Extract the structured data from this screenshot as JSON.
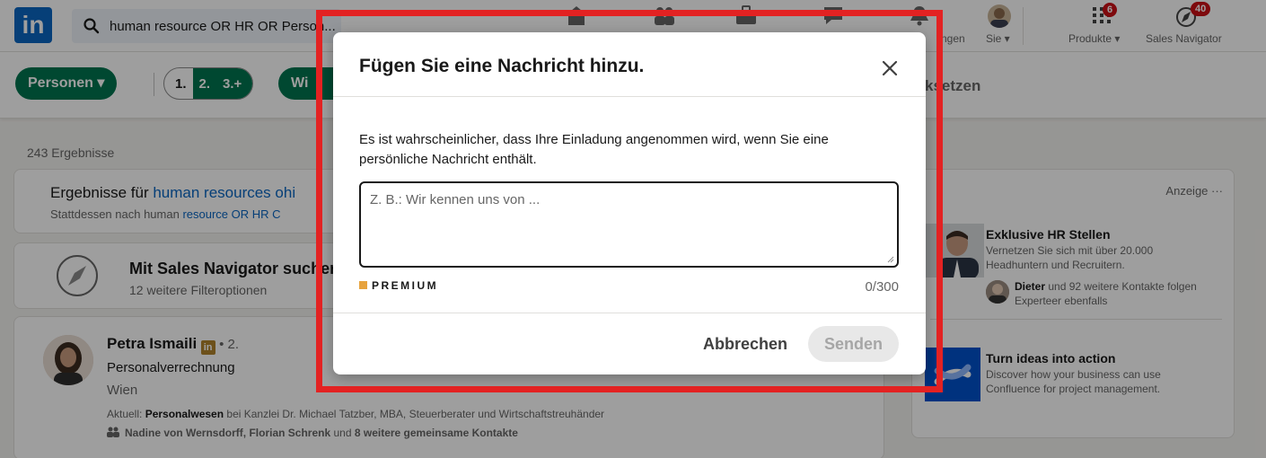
{
  "nav": {
    "search_value": "human resource OR HR OR Person...",
    "items": [
      {
        "label": "ngen"
      },
      {
        "label": "Sie ▾"
      },
      {
        "label": "Produkte ▾",
        "badge": "6"
      },
      {
        "label": "Sales Navigator",
        "badge": "40"
      }
    ]
  },
  "filters": {
    "people_label": "Personen ▾",
    "degrees": [
      "1.",
      "2.",
      "3.+"
    ],
    "location_label": "Wi",
    "reset_label": "ksetzen"
  },
  "results": {
    "count": "243 Ergebnisse",
    "spelling_prefix": "Ergebnisse für ",
    "spelling_link": "human resources o",
    "spelling_tail": "hi",
    "instead_prefix": "Stattdessen nach human ",
    "instead_link": "resource OR H",
    "instead_tail": "R C",
    "sales_title": "Mit Sales Navigator such",
    "sales_tail": "er",
    "sales_sub": "12 weitere Filteroptionen",
    "person": {
      "name": "Petra Ismaili",
      "degree": "• 2.",
      "headline": "Personalverrechnung",
      "location": "Wien",
      "current_prefix": "Aktuell: ",
      "current_bold": "Personalwesen",
      "current_rest": " bei Kanzlei Dr. Michael Tatzber, MBA, Steuerberater und Wirtschaftstreuhänder",
      "mutual_bold": "Nadine von Wernsdorff, Florian Schrenk",
      "mutual_mid": " und ",
      "mutual_end": "8 weitere gemeinsame Kontakte"
    }
  },
  "ads": {
    "label": "Anzeige ···",
    "ad1": {
      "title": "Exklusive HR Stellen",
      "body": "Vernetzen Sie sich mit über 20.000 Headhuntern und Recruitern.",
      "social_bold": "Dieter",
      "social_rest": " und 92 weitere Kontakte folgen Experteer ebenfalls"
    },
    "ad2": {
      "title": "Turn ideas into action",
      "body": "Discover how your business can use Confluence for project management."
    }
  },
  "modal": {
    "title": "Fügen Sie eine Nachricht hinzu.",
    "description": "Es ist wahrscheinlicher, dass Ihre Einladung angenommen wird, wenn Sie eine persönliche Nachricht enthält.",
    "placeholder": "Z. B.: Wir kennen uns von ...",
    "premium": "PREMIUM",
    "counter": "0/300",
    "cancel": "Abbrechen",
    "send": "Senden"
  },
  "colors": {
    "brand": "#0a66c2",
    "green": "#01754f",
    "annotation": "#e32222",
    "premium": "#e7a33e"
  }
}
